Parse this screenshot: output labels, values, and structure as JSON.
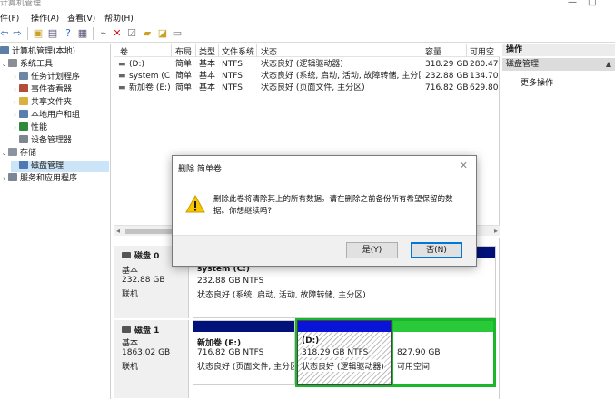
{
  "window": {
    "title": "计算机管理"
  },
  "menu": [
    {
      "label": "件(F)"
    },
    {
      "label": "操作(A)"
    },
    {
      "label": "查看(V)"
    },
    {
      "label": "帮助(H)"
    }
  ],
  "tree": {
    "root": "计算机管理(本地)",
    "system_tools": "系统工具",
    "task_scheduler": "任务计划程序",
    "event_viewer": "事件查看器",
    "shared_folders": "共享文件夹",
    "local_users": "本地用户和组",
    "performance": "性能",
    "device_manager": "设备管理器",
    "storage": "存储",
    "disk_management": "磁盘管理",
    "services": "服务和应用程序"
  },
  "volume_list": {
    "columns": [
      "卷",
      "布局",
      "类型",
      "文件系统",
      "状态",
      "容量",
      "可用空"
    ],
    "rows": [
      [
        "(D:)",
        "简单",
        "基本",
        "NTFS",
        "状态良好 (逻辑驱动器)",
        "318.29 GB",
        "280.47"
      ],
      [
        "system (C:)",
        "简单",
        "基本",
        "NTFS",
        "状态良好 (系统, 启动, 活动, 故障转储, 主分区)",
        "232.88 GB",
        "134.70"
      ],
      [
        "新加卷 (E:)",
        "简单",
        "基本",
        "NTFS",
        "状态良好 (页面文件, 主分区)",
        "716.82 GB",
        "629.80"
      ]
    ]
  },
  "disks": {
    "disk0": {
      "name": "磁盘 0",
      "type": "基本",
      "size": "232.88 GB",
      "state": "联机",
      "part_c": {
        "name": "system  (C:)",
        "size": "232.88 GB NTFS",
        "status": "状态良好 (系统, 启动, 活动, 故障转储, 主分区)"
      }
    },
    "disk1": {
      "name": "磁盘 1",
      "type": "基本",
      "size": "1863.02 GB",
      "state": "联机",
      "part_e": {
        "name": "新加卷  (E:)",
        "size": "716.82 GB NTFS",
        "status": "状态良好 (页面文件, 主分区"
      },
      "part_d": {
        "name": "(D:)",
        "size": "318.29 GB NTFS",
        "status": "状态良好 (逻辑驱动器)"
      },
      "part_free": {
        "size": "827.90 GB",
        "status": "可用空间"
      }
    }
  },
  "actions": {
    "header": "操作",
    "section": "磁盘管理",
    "more": "更多操作"
  },
  "dialog": {
    "title": "删除 简单卷",
    "message": "删除此卷将清除其上的所有数据。请在删除之前备份所有希望保留的数据。你想继续吗?",
    "yes": "是(Y)",
    "no": "否(N)"
  },
  "colors": {
    "primary_bar": "#00127a",
    "logical_bar": "#0a14d8",
    "free_bar": "#29c93a",
    "free_border": "#18b82a",
    "selection": "#cce4f7"
  }
}
